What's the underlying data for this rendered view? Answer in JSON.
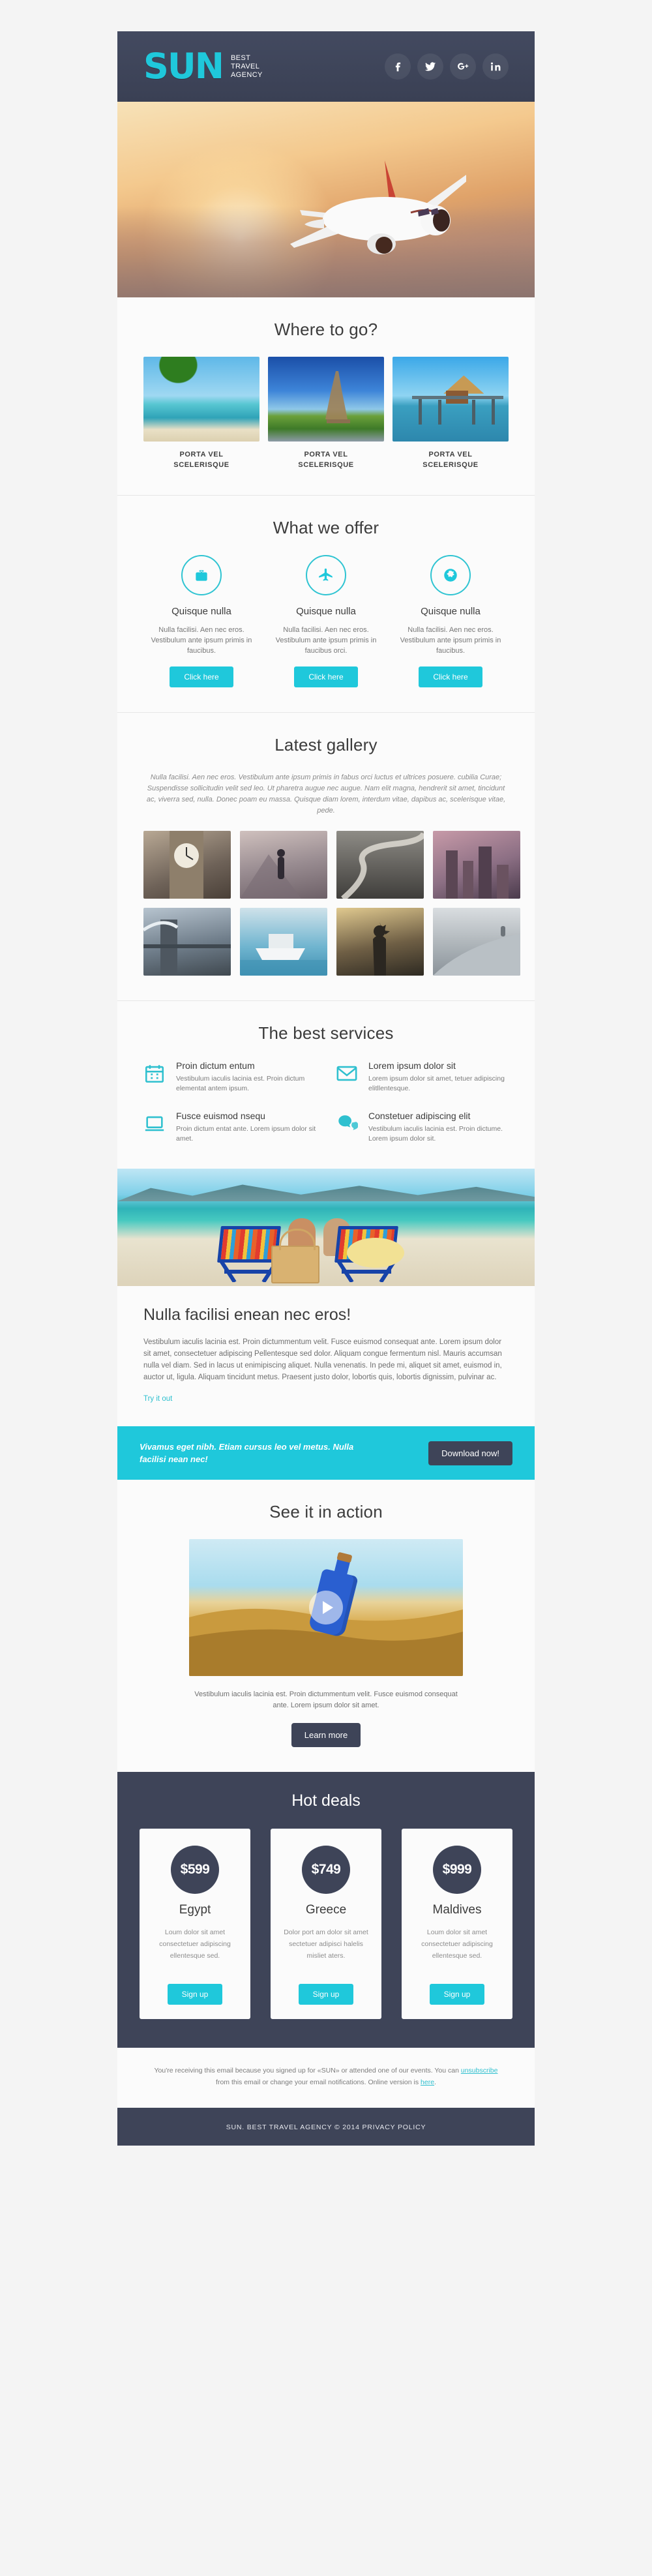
{
  "colors": {
    "accent": "#1fc8db",
    "dark": "#3e4458",
    "page_bg": "#f4f4f4",
    "card_bg": "#fbfbfb"
  },
  "header": {
    "logo": "SUN",
    "tagline_line1": "BEST",
    "tagline_line2": "TRAVEL",
    "tagline_line3": "AGENCY",
    "socials": [
      {
        "name": "facebook-icon",
        "label": "f"
      },
      {
        "name": "twitter-icon",
        "label": "t"
      },
      {
        "name": "google-plus-icon",
        "label": "g+"
      },
      {
        "name": "linkedin-icon",
        "label": "in"
      }
    ]
  },
  "hero": {
    "alt": "airplane-flying-at-sunset"
  },
  "where_to_go": {
    "title": "Where to go?",
    "cards": [
      {
        "caption_line1": "PORTA VEL",
        "caption_line2": "SCELERISQUE",
        "alt": "tropical-beach-with-palm-trees-and-boat"
      },
      {
        "caption_line1": "PORTA VEL",
        "caption_line2": "SCELERISQUE",
        "alt": "eiffel-tower-paris"
      },
      {
        "caption_line1": "PORTA VEL",
        "caption_line2": "SCELERISQUE",
        "alt": "overwater-bungalow-pier"
      }
    ]
  },
  "what_we_offer": {
    "title": "What we offer",
    "items": [
      {
        "icon": "suitcase-icon",
        "heading": "Quisque nulla",
        "text": "Nulla facilisi. Aen nec eros. Vestibulum ante ipsum primis in faucibus.",
        "button": "Click here"
      },
      {
        "icon": "airplane-icon",
        "heading": "Quisque nulla",
        "text": "Nulla facilisi. Aen nec eros. Vestibulum ante ipsum primis in faucibus orci.",
        "button": "Click here"
      },
      {
        "icon": "globe-icon",
        "heading": "Quisque nulla",
        "text": "Nulla facilisi. Aen nec eros. Vestibulum ante ipsum primis in faucibus.",
        "button": "Click here"
      }
    ]
  },
  "gallery": {
    "title": "Latest gallery",
    "lead": "Nulla facilisi. Aen nec eros. Vestibulum ante ipsum primis in fabus orci luctus et ultrices posuere. cubilia Curae; Suspendisse sollicitudin velit sed leo. Ut pharetra augue nec augue. Nam elit magna, hendrerit sit amet, tincidunt ac, viverra sed, nulla. Donec poam eu massa. Quisque diam lorem, interdum vitae, dapibus ac, scelerisque vitae, pede.",
    "thumbs": [
      {
        "alt": "big-ben-clock-tower"
      },
      {
        "alt": "hiker-on-mountain-ridge"
      },
      {
        "alt": "winding-mountain-road"
      },
      {
        "alt": "city-skyline-at-night"
      },
      {
        "alt": "tower-bridge-london"
      },
      {
        "alt": "motor-yacht-on-sea"
      },
      {
        "alt": "statue-of-liberty"
      },
      {
        "alt": "person-on-snowy-dune"
      }
    ]
  },
  "services": {
    "title": "The best services",
    "items": [
      {
        "icon": "calendar-icon",
        "heading": "Proin dictum entum",
        "text": "Vestibulum iaculis lacinia est. Proin dictum elementat antem ipsum."
      },
      {
        "icon": "envelope-icon",
        "heading": "Lorem ipsum dolor sit",
        "text": "Lorem ipsum dolor sit amet, tetuer adipiscing elitllentesque."
      },
      {
        "icon": "laptop-icon",
        "heading": "Fusce euismod nsequ",
        "text": "Proin dictum entat ante. Lorem ipsum dolor sit amet."
      },
      {
        "icon": "chat-bubbles-icon",
        "heading": "Constetuer adipiscing elit",
        "text": "Vestibulum iaculis lacinia est. Proin dictume. Lorem ipsum dolor sit."
      }
    ]
  },
  "article": {
    "image_alt": "couple-kissing-on-beach-chairs",
    "title": "Nulla facilisi enean nec eros!",
    "body": "Vestibulum iaculis lacinia est. Proin dictummentum velit. Fusce euismod consequat ante. Lorem ipsum dolor sit amet, consectetuer adipiscing  Pellentesque sed dolor. Aliquam congue fermentum nisl. Mauris accumsan nulla vel diam. Sed in lacus ut enimipiscing aliquet. Nulla venenatis. In pede mi, aliquet sit amet, euismod in, auctor ut, ligula. Aliquam  tincidunt metus. Praesent justo dolor, lobortis quis, lobortis dignissim, pulvinar ac.",
    "link": "Try it out"
  },
  "cta": {
    "text": "Vivamus eget nibh. Etiam cursus leo vel metus. Nulla facilisi nean nec!",
    "button": "Download now!"
  },
  "video_section": {
    "title": "See it in action",
    "image_alt": "message-in-a-bottle-on-sand",
    "play_icon": "play-icon",
    "caption": "Vestibulum iaculis lacinia est. Proin dictummentum velit. Fusce euismod consequat ante. Lorem ipsum dolor sit amet.",
    "button": "Learn more"
  },
  "hot_deals": {
    "title": "Hot deals",
    "deals": [
      {
        "price": "$599",
        "country": "Egypt",
        "text": "Loum dolor sit amet consectetuer adipiscing ellentesque sed.",
        "button": "Sign up"
      },
      {
        "price": "$749",
        "country": "Greece",
        "text": "Dolor port am dolor sit amet sectetuer adipisci halelis misliet aters.",
        "button": "Sign up"
      },
      {
        "price": "$999",
        "country": "Maldives",
        "text": "Loum dolor sit amet consectetuer adipiscing ellentesque sed.",
        "button": "Sign up"
      }
    ]
  },
  "footer": {
    "legal_part1": "You're receiving this email because you signed up for «SUN» or attended one of our events. You can ",
    "legal_link1": "unsubscribe",
    "legal_part2": " from this email or change your email notifications. Online version is ",
    "legal_link2": "here",
    "legal_part3": ".",
    "copyright": "SUN. BEST  TRAVEL  AGENCY © 2014 PRIVACY POLICY"
  }
}
